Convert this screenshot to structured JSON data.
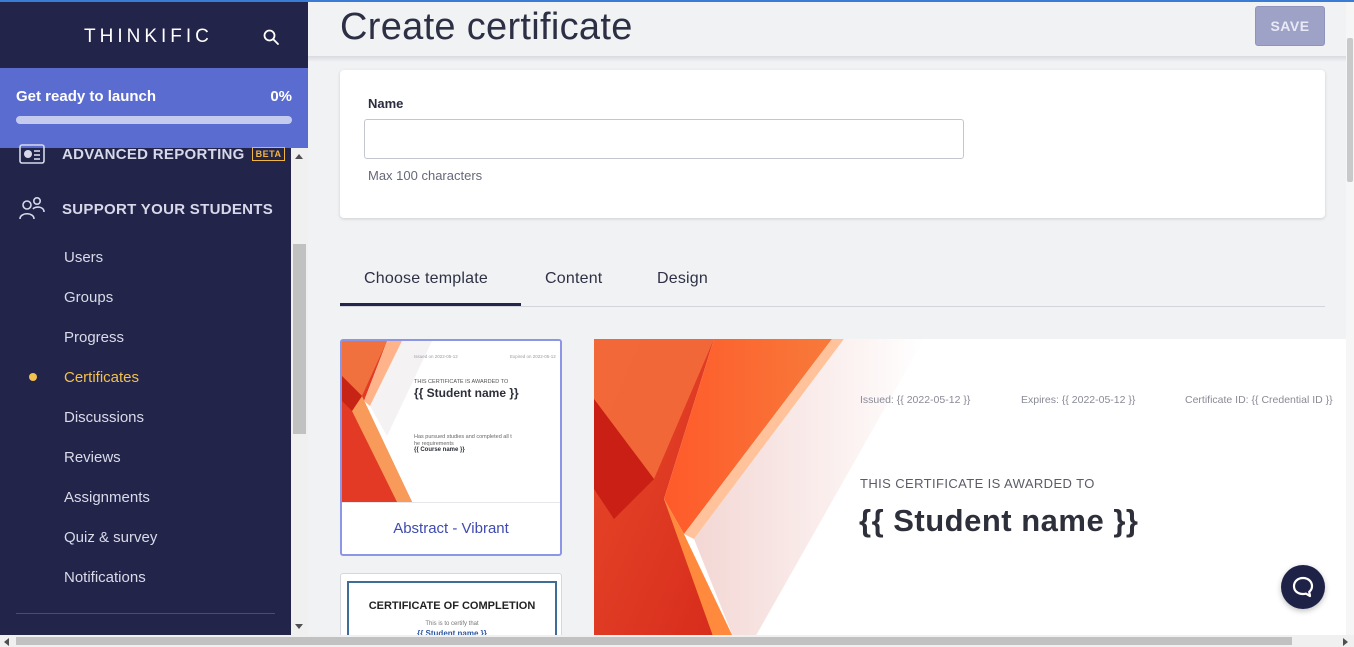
{
  "sidebar": {
    "brand": "THINKIFIC",
    "launch": {
      "label": "Get ready to launch",
      "percent_text": "0%",
      "progress_fraction": 0
    },
    "sections": [
      {
        "label": "ADVANCED REPORTING",
        "badge": "BETA",
        "icon": "report-icon"
      },
      {
        "label": "SUPPORT YOUR STUDENTS",
        "icon": "students-icon"
      }
    ],
    "items": [
      {
        "label": "Users"
      },
      {
        "label": "Groups"
      },
      {
        "label": "Progress"
      },
      {
        "label": "Certificates",
        "active": true
      },
      {
        "label": "Discussions"
      },
      {
        "label": "Reviews"
      },
      {
        "label": "Assignments"
      },
      {
        "label": "Quiz & survey"
      },
      {
        "label": "Notifications"
      }
    ]
  },
  "header": {
    "title": "Create certificate",
    "save_label": "SAVE"
  },
  "form": {
    "name_label": "Name",
    "name_value": "",
    "name_help": "Max 100 characters"
  },
  "tabs": [
    {
      "label": "Choose template",
      "active": true
    },
    {
      "label": "Content"
    },
    {
      "label": "Design"
    }
  ],
  "templates": [
    {
      "label": "Abstract - Vibrant",
      "thumb": {
        "issued": "Issued on 2022-05-12",
        "expires": "Expired on 2022-05-12",
        "awarded": "THIS CERTIFICATE IS AWARDED TO",
        "student": "{{ Student name }}",
        "pursued": "Has pursued studies and completed all t",
        "requirements": "he requirements",
        "course": "{{ Course name }}"
      }
    },
    {
      "title": "CERTIFICATE OF COMPLETION",
      "subtitle": "This is to certify that",
      "student": "{{ Student name }}"
    }
  ],
  "preview": {
    "issued": "Issued: {{ 2022-05-12 }}",
    "expires": "Expires: {{ 2022-05-12 }}",
    "credential": "Certificate ID: {{ Credential ID }}",
    "awarded": "THIS CERTIFICATE IS AWARDED TO",
    "student": "{{ Student name }}"
  },
  "colors": {
    "sidebar": "#22244a",
    "launch": "#5b6cd1",
    "accent": "#3f4bb0",
    "active_item": "#f2c14e",
    "save_disabled": "#9ea2c6"
  }
}
